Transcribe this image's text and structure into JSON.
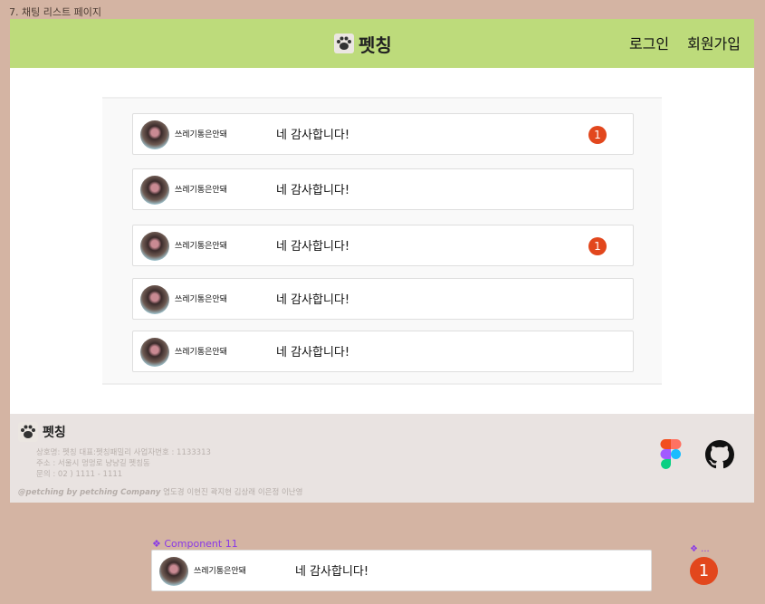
{
  "frame_label": "7. 채팅 리스트 페이지",
  "header": {
    "logo_text": "펫칭",
    "nav": {
      "login": "로그인",
      "signup": "회원가입"
    },
    "background": "#bddb7b"
  },
  "chat_list": {
    "items": [
      {
        "nickname": "쓰레기통은안돼",
        "message": "네 감사합니다!",
        "unread": "1"
      },
      {
        "nickname": "쓰레기통은안돼",
        "message": "네 감사합니다!",
        "unread": ""
      },
      {
        "nickname": "쓰레기통은안돼",
        "message": "네 감사합니다!",
        "unread": "1"
      },
      {
        "nickname": "쓰레기통은안돼",
        "message": "네 감사합니다!",
        "unread": ""
      },
      {
        "nickname": "쓰레기통은안돼",
        "message": "네 감사합니다!",
        "unread": ""
      }
    ]
  },
  "footer": {
    "logo_text": "펫칭",
    "info_line1": "상호명: 펫칭 대표:펫칭패밀리 사업자번호 : 1133313",
    "info_line2": "주소 : 서울시 멍멍로 냥냥길 펫칭동",
    "info_line3": "문의 : 02 ) 1111 - 1111",
    "credit_company": "@petching by petching Company",
    "credit_members": " 염도경 이현진 곽지현 김상래 이은정 이난영",
    "icons": [
      "figma-icon",
      "github-icon"
    ]
  },
  "component": {
    "label": "❖ Component 11",
    "nickname": "쓰레기통은안돼",
    "message": "네 감사합니다!",
    "small_label": "❖ ...",
    "badge": "1"
  },
  "colors": {
    "canvas": "#d4b4a3",
    "badge": "#e2471d",
    "component_label": "#8a3ae6"
  }
}
